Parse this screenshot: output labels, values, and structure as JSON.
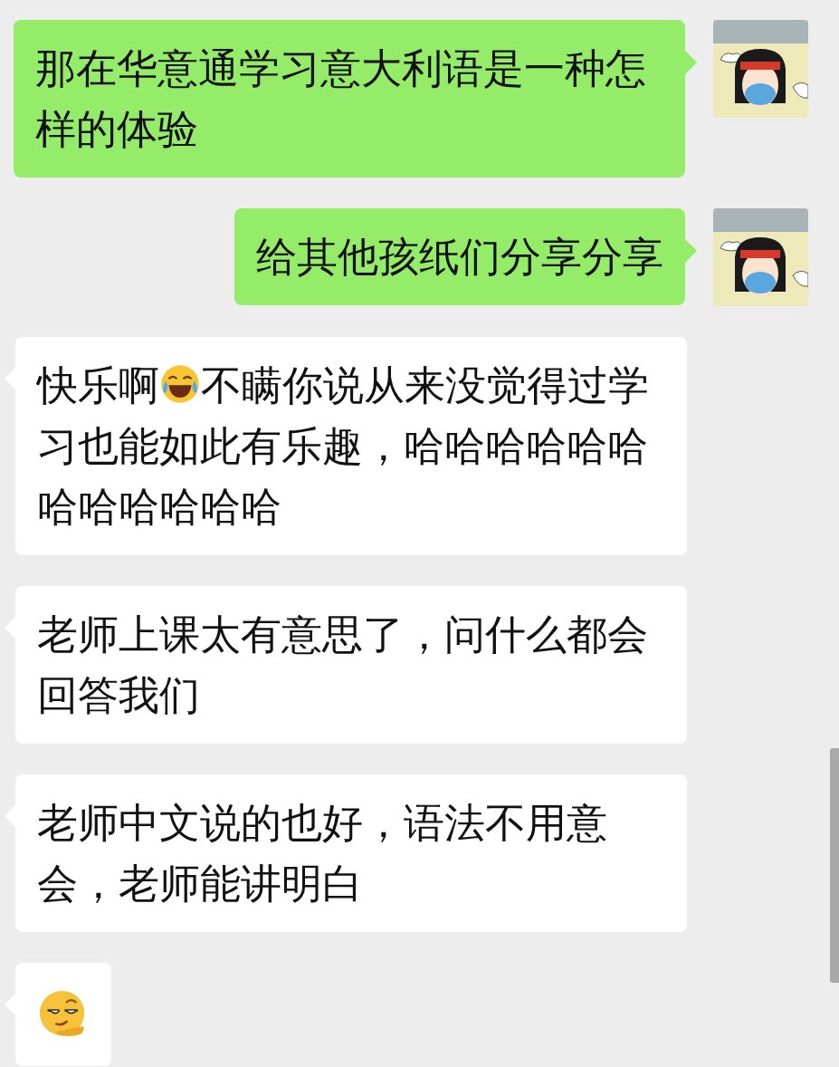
{
  "messages": [
    {
      "kind": "sent",
      "segments": [
        {
          "kind": "text",
          "text": "那在华意通学习意大利语是一种怎样的体验"
        }
      ]
    },
    {
      "kind": "sent",
      "segments": [
        {
          "kind": "text",
          "text": "给其他孩纸们分享分享"
        }
      ]
    },
    {
      "kind": "received",
      "segments": [
        {
          "kind": "text",
          "text": "快乐啊"
        },
        {
          "kind": "emoji-laugh"
        },
        {
          "kind": "text",
          "text": "不瞒你说从来没觉得过学习也能如此有乐趣，哈哈哈哈哈哈哈哈哈哈哈哈"
        }
      ]
    },
    {
      "kind": "received",
      "segments": [
        {
          "kind": "text",
          "text": "老师上课太有意思了，问什么都会回答我们"
        }
      ]
    },
    {
      "kind": "received",
      "segments": [
        {
          "kind": "text",
          "text": "老师中文说的也好，语法不用意会，老师能讲明白"
        }
      ]
    },
    {
      "kind": "received",
      "segments": [
        {
          "kind": "emoji-smirk"
        }
      ]
    }
  ]
}
